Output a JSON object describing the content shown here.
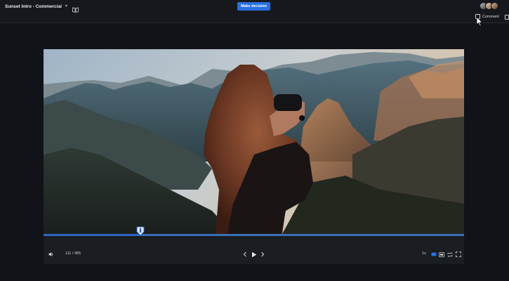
{
  "header": {
    "title": "Sunset Intro - Commercial",
    "make_decision_label": "Make decision",
    "comment_label": "Comment",
    "avatar_count": 3
  },
  "player": {
    "frame_counter": "111 / 455",
    "speed": "1x",
    "progress_fraction": 0.23
  },
  "colors": {
    "accent": "#2a6fe0",
    "background": "#111318",
    "controls_bar": "#1a1d22"
  },
  "icons": [
    "book-icon",
    "chevron-down-icon",
    "comment-icon",
    "panel-icon",
    "volume-icon",
    "previous-frame-icon",
    "play-icon",
    "next-frame-icon",
    "quality-icon",
    "subtitles-icon",
    "loop-icon",
    "fullscreen-icon"
  ]
}
